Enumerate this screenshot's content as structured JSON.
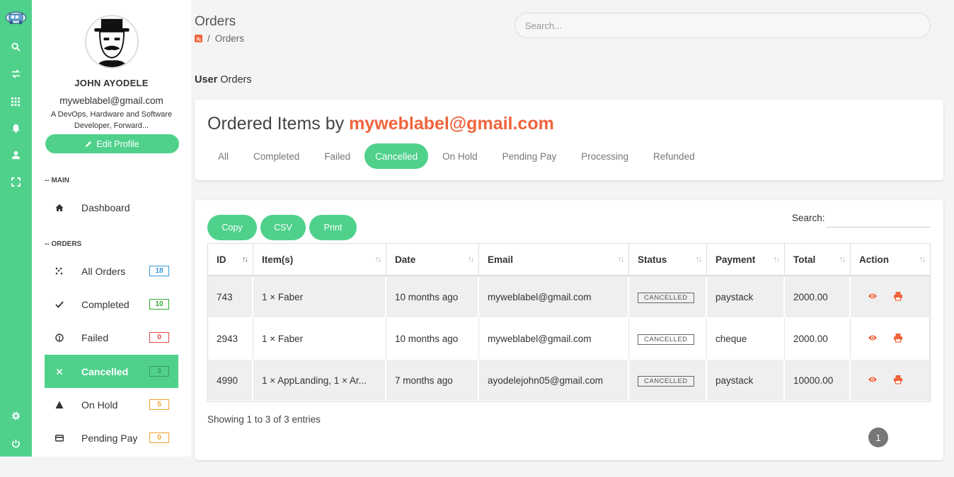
{
  "profile": {
    "name": "JOHN AYODELE",
    "email": "myweblabel@gmail.com",
    "bio": "A DevOps, Hardware and Software Developer, Forward...",
    "edit_label": "Edit Profile"
  },
  "sidebar": {
    "main_label": "-- MAIN",
    "orders_label": "-- ORDERS",
    "dashboard": "Dashboard",
    "items": [
      {
        "label": "All Orders",
        "count": "18",
        "color": "#3a9ad9"
      },
      {
        "label": "Completed",
        "count": "10",
        "color": "#2eaa2e"
      },
      {
        "label": "Failed",
        "count": "0",
        "color": "#e04848"
      },
      {
        "label": "Cancelled",
        "count": "3",
        "color": "#3a9a66"
      },
      {
        "label": "On Hold",
        "count": "5",
        "color": "#f0a030"
      },
      {
        "label": "Pending Pay",
        "count": "0",
        "color": "#f0a030"
      }
    ]
  },
  "header": {
    "title": "Orders",
    "breadcrumb": "Orders",
    "search_placeholder": "Search..."
  },
  "subheading": {
    "bold": "User",
    "rest": " Orders"
  },
  "card": {
    "title_prefix": "Ordered Items by ",
    "title_email": "myweblabel@gmail.com",
    "tabs": [
      "All",
      "Completed",
      "Failed",
      "Cancelled",
      "On Hold",
      "Pending Pay",
      "Processing",
      "Refunded"
    ],
    "active_tab": "Cancelled"
  },
  "table": {
    "buttons": [
      "Copy",
      "CSV",
      "Print"
    ],
    "search_label": "Search:",
    "columns": [
      "ID",
      "Item(s)",
      "Date",
      "Email",
      "Status",
      "Payment",
      "Total",
      "Action"
    ],
    "rows": [
      {
        "id": "743",
        "items": "1 × Faber",
        "date": "10 months ago",
        "email": "myweblabel@gmail.com",
        "status": "CANCELLED",
        "payment": "paystack",
        "total": "2000.00"
      },
      {
        "id": "2943",
        "items": "1 × Faber",
        "date": "10 months ago",
        "email": "myweblabel@gmail.com",
        "status": "CANCELLED",
        "payment": "cheque",
        "total": "2000.00"
      },
      {
        "id": "4990",
        "items": "1 × AppLanding, 1 × Ar...",
        "date": "7 months ago",
        "email": "ayodelejohn05@gmail.com",
        "status": "CANCELLED",
        "payment": "paystack",
        "total": "10000.00"
      }
    ],
    "info": "Showing 1 to 3 of 3 entries",
    "page": "1"
  },
  "colors": {
    "accent": "#4fd18b",
    "brand_orange": "#f0643c"
  }
}
